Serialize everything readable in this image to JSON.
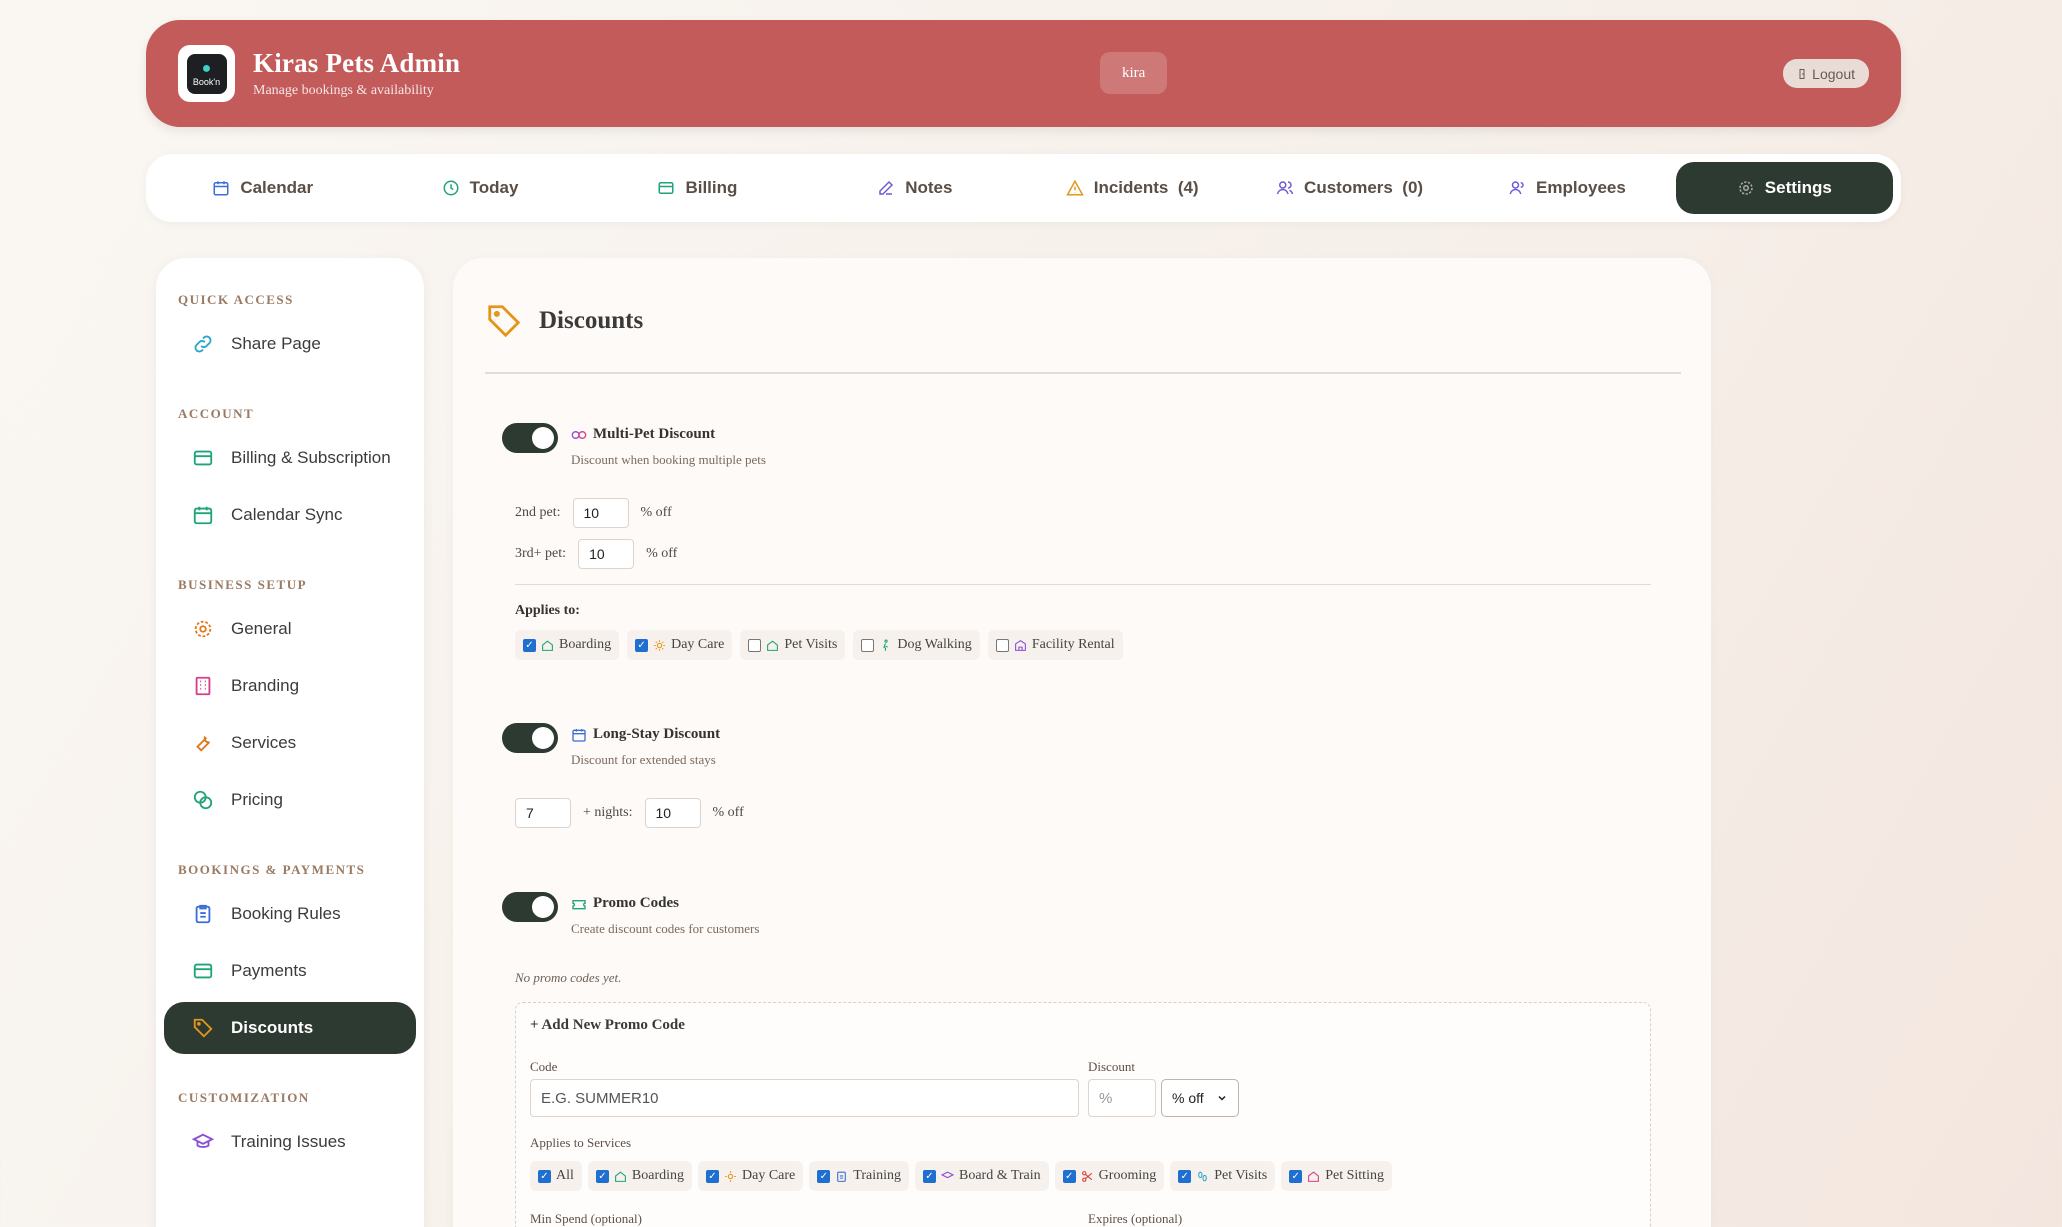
{
  "header": {
    "logo_text": "Book'n",
    "title": "Kiras Pets Admin",
    "subtitle": "Manage bookings & availability",
    "user": "kira",
    "logout_label": "Logout"
  },
  "nav": {
    "items": [
      {
        "label": "Calendar",
        "icon": "calendar-icon"
      },
      {
        "label": "Today",
        "icon": "clock-icon"
      },
      {
        "label": "Billing",
        "icon": "card-icon"
      },
      {
        "label": "Notes",
        "icon": "edit-icon"
      },
      {
        "label": "Incidents  (4)",
        "icon": "warning-icon"
      },
      {
        "label": "Customers  (0)",
        "icon": "users-icon"
      },
      {
        "label": "Employees",
        "icon": "user-icon"
      },
      {
        "label": "Settings",
        "icon": "gear-icon"
      }
    ],
    "active": "Settings"
  },
  "sidebar": {
    "sections": [
      {
        "title": "QUICK ACCESS",
        "items": [
          {
            "label": "Share Page",
            "icon": "link-icon"
          }
        ]
      },
      {
        "title": "ACCOUNT",
        "items": [
          {
            "label": "Billing & Subscription",
            "icon": "card-icon"
          },
          {
            "label": "Calendar Sync",
            "icon": "calendar-icon"
          }
        ]
      },
      {
        "title": "BUSINESS SETUP",
        "items": [
          {
            "label": "General",
            "icon": "gear-icon"
          },
          {
            "label": "Branding",
            "icon": "building-icon"
          },
          {
            "label": "Services",
            "icon": "wrench-icon"
          },
          {
            "label": "Pricing",
            "icon": "coins-icon"
          }
        ]
      },
      {
        "title": "BOOKINGS & PAYMENTS",
        "items": [
          {
            "label": "Booking Rules",
            "icon": "clipboard-icon"
          },
          {
            "label": "Payments",
            "icon": "card-icon"
          },
          {
            "label": "Discounts",
            "icon": "tag-icon"
          }
        ]
      },
      {
        "title": "CUSTOMIZATION",
        "items": [
          {
            "label": "Training Issues",
            "icon": "graduation-cap-icon"
          }
        ]
      }
    ],
    "active": "Discounts"
  },
  "main": {
    "title": "Discounts",
    "multi_pet": {
      "title": "Multi-Pet Discount",
      "subtitle": "Discount when booking multiple pets",
      "enabled": true,
      "second_label": "2nd pet:",
      "second_value": "10",
      "third_label": "3rd+ pet:",
      "third_value": "10",
      "off_label": "% off",
      "applies_label": "Applies to:",
      "services": [
        {
          "label": "Boarding",
          "checked": true
        },
        {
          "label": "Day Care",
          "checked": true
        },
        {
          "label": "Pet Visits",
          "checked": false
        },
        {
          "label": "Dog Walking",
          "checked": false
        },
        {
          "label": "Facility Rental",
          "checked": false
        }
      ]
    },
    "long_stay": {
      "title": "Long-Stay Discount",
      "subtitle": "Discount for extended stays",
      "enabled": true,
      "nights_value": "7",
      "nights_label": "+ nights:",
      "discount_value": "10",
      "off_label": "% off"
    },
    "promo": {
      "title": "Promo Codes",
      "subtitle": "Create discount codes for customers",
      "enabled": true,
      "empty_text": "No promo codes yet.",
      "add_title": "+ Add New Promo Code",
      "code_label": "Code",
      "code_placeholder": "E.G. SUMMER10",
      "discount_label": "Discount",
      "discount_placeholder": "%",
      "discount_type": "% off",
      "applies_label": "Applies to Services",
      "services": [
        {
          "label": "All",
          "checked": true
        },
        {
          "label": "Boarding",
          "checked": true
        },
        {
          "label": "Day Care",
          "checked": true
        },
        {
          "label": "Training",
          "checked": true
        },
        {
          "label": "Board & Train",
          "checked": true
        },
        {
          "label": "Grooming",
          "checked": true
        },
        {
          "label": "Pet Visits",
          "checked": true
        },
        {
          "label": "Pet Sitting",
          "checked": true
        }
      ],
      "min_spend_label": "Min Spend (optional)",
      "expires_label": "Expires (optional)"
    }
  }
}
